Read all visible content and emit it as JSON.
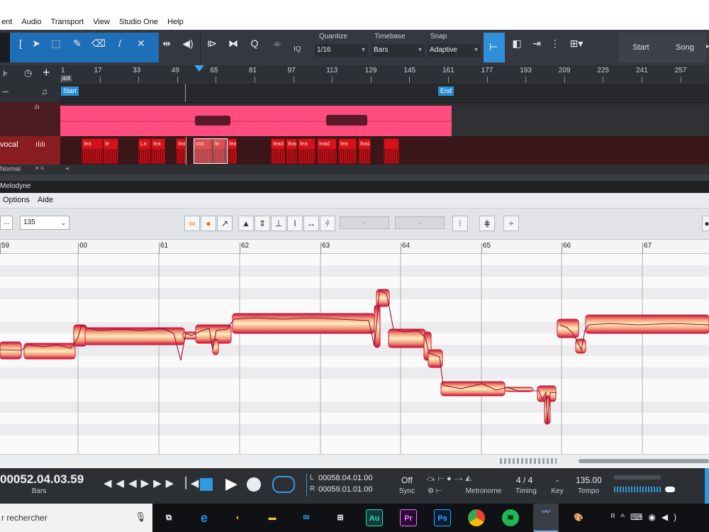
{
  "menu": [
    "ent",
    "Audio",
    "Transport",
    "View",
    "Studio One",
    "Help"
  ],
  "toolbar": {
    "quantize_label": "Quantize",
    "quantize_value": "1/16",
    "timebase_label": "Timebase",
    "timebase_value": "Bars",
    "snap_label": "Snap",
    "snap_value": "Adaptive",
    "iq_label": "IQ",
    "start_label": "Start",
    "song_label": "Song"
  },
  "ruler": {
    "signature": "4/4",
    "bar_numbers": [
      "1",
      "17",
      "33",
      "49",
      "65",
      "81",
      "97",
      "113",
      "129",
      "145",
      "161",
      "177",
      "193",
      "209",
      "225",
      "241",
      "257"
    ],
    "start_marker": "Start",
    "end_marker": "End"
  },
  "tracks": {
    "track2_name": "vocal",
    "footer_mode": "Normal",
    "clip_labels": [
      "lea",
      "le",
      "Le",
      "lea",
      "lead",
      "voc",
      "le",
      "lea",
      "lead",
      "lead",
      "lea",
      "lead",
      "lea",
      "lead"
    ]
  },
  "melodyne": {
    "title": "Melodyne",
    "menu": [
      "Options",
      "Aide"
    ],
    "tempo_prefix": "...",
    "tempo": "135",
    "field_dash_1": "-",
    "field_dash_2": "-",
    "bar_numbers": [
      "59",
      "60",
      "61",
      "62",
      "63",
      "64",
      "65",
      "66",
      "67"
    ]
  },
  "transport": {
    "position": "00052.04.03.59",
    "position_unit": "Bars",
    "loop_l_prefix": "L",
    "loop_l": "00058.04.01.00",
    "loop_r_prefix": "R",
    "loop_r": "00059.01.01.00",
    "sync_value": "Off",
    "sync_label": "Sync",
    "metronome_label": "Metronome",
    "timing_value": "4 / 4",
    "timing_label": "Timing",
    "key_value": "-",
    "key_label": "Key",
    "tempo_value": "135.00",
    "tempo_label": "Tempo"
  },
  "taskbar": {
    "search_placeholder": "r rechercher",
    "app_au": "Au",
    "app_pr": "Pr",
    "app_ps": "Ps"
  },
  "colors": {
    "toolbar_bg": "#35393f",
    "clip_pink": "#ff4d7f",
    "clip_red": "#d3121a",
    "blob_fill": "#f6e2a3",
    "blob_edge": "#c8123a",
    "accent_blue": "#1e90d6"
  }
}
